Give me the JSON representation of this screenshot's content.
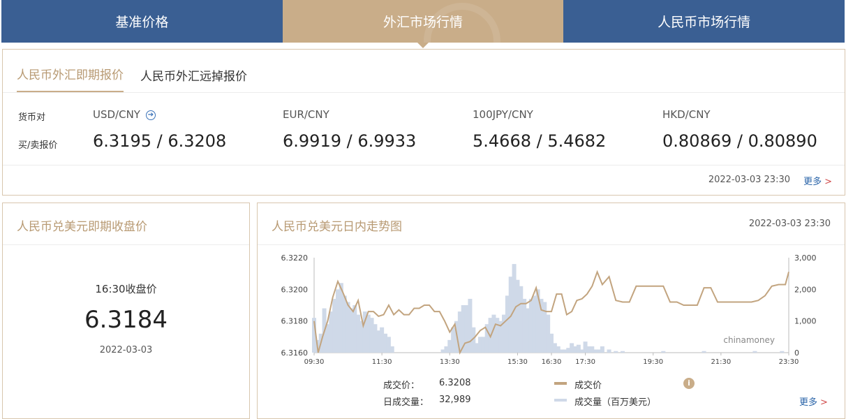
{
  "top_tabs": [
    {
      "label": "基准价格"
    },
    {
      "label": "外汇市场行情"
    },
    {
      "label": "人民币市场行情"
    }
  ],
  "quote": {
    "tabs": [
      {
        "label": "人民币外汇即期报价"
      },
      {
        "label": "人民币外汇远掉报价"
      }
    ],
    "row_labels": {
      "pair": "货币对",
      "price": "买/卖报价"
    },
    "pairs": [
      {
        "name": "USD/CNY",
        "price": "6.3195 / 6.3208"
      },
      {
        "name": "EUR/CNY",
        "price": "6.9919 / 6.9933"
      },
      {
        "name": "100JPY/CNY",
        "price": "5.4668 / 5.4682"
      },
      {
        "name": "HKD/CNY",
        "price": "0.80869 / 0.80890"
      }
    ],
    "timestamp": "2022-03-03 23:30",
    "more": "更多"
  },
  "close": {
    "title": "人民币兑美元即期收盘价",
    "label": "16:30收盘价",
    "value": "6.3184",
    "date": "2022-03-03"
  },
  "intraday": {
    "title": "人民币兑美元日内走势图",
    "timestamp": "2022-03-03 23:30",
    "watermark": "chinamoney",
    "deal_price_label": "成交价：",
    "deal_price": "6.3208",
    "volume_label": "日成交量：",
    "volume": "32,989",
    "legend_price": "成交价",
    "legend_volume": "成交量（百万美元）",
    "more": "更多",
    "price_color": "#c2a47f",
    "volume_color": "#cfd9e8"
  },
  "chart_data": {
    "type": "line",
    "x_ticks": [
      "09:30",
      "11:30",
      "13:30",
      "15:30",
      "16:30",
      "17:30",
      "19:30",
      "21:30",
      "23:30"
    ],
    "x_tick_hours": [
      9.5,
      11.5,
      13.5,
      15.5,
      16.5,
      17.5,
      19.5,
      21.5,
      23.5
    ],
    "y_left_ticks": [
      "6.3220",
      "6.3200",
      "6.3180",
      "6.3160"
    ],
    "y_left_range": [
      6.316,
      6.322
    ],
    "y_right_ticks": [
      "3,000",
      "2,000",
      "1,000",
      "0"
    ],
    "y_right_range": [
      0,
      3000
    ],
    "series": [
      {
        "name": "成交价",
        "x": [
          9.5,
          9.62,
          9.75,
          9.9,
          10.05,
          10.2,
          10.35,
          10.5,
          10.65,
          10.8,
          10.95,
          11.1,
          11.25,
          11.4,
          11.55,
          11.7,
          11.85,
          12.0,
          12.15,
          12.3,
          12.45,
          12.6,
          12.75,
          12.9,
          13.05,
          13.2,
          13.35,
          13.5,
          13.65,
          13.8,
          13.95,
          14.1,
          14.25,
          14.4,
          14.55,
          14.7,
          14.85,
          15.0,
          15.15,
          15.3,
          15.45,
          15.6,
          15.75,
          15.9,
          16.05,
          16.2,
          16.35,
          16.5,
          16.65,
          16.8,
          16.95,
          17.1,
          17.25,
          17.4,
          17.55,
          17.7,
          17.85,
          18.0,
          18.2,
          18.4,
          18.6,
          18.8,
          19.0,
          19.2,
          19.4,
          19.6,
          19.8,
          20.0,
          20.2,
          20.4,
          20.6,
          20.8,
          21.0,
          21.2,
          21.4,
          21.6,
          21.8,
          22.0,
          22.2,
          22.4,
          22.6,
          22.8,
          23.0,
          23.2,
          23.4,
          23.5
        ],
        "values": [
          6.318,
          6.316,
          6.317,
          6.318,
          6.3195,
          6.3205,
          6.3198,
          6.319,
          6.3186,
          6.3193,
          6.3177,
          6.3186,
          6.3186,
          6.3183,
          6.3184,
          6.319,
          6.3184,
          6.3187,
          6.3184,
          6.3184,
          6.3188,
          6.3188,
          6.319,
          6.319,
          6.3186,
          6.3186,
          6.318,
          6.3173,
          6.3178,
          6.316,
          6.3166,
          6.3167,
          6.317,
          6.3174,
          6.3176,
          6.317,
          6.3178,
          6.3177,
          6.318,
          6.3183,
          6.3189,
          6.3191,
          6.3191,
          6.3193,
          6.3201,
          6.3187,
          6.3186,
          6.3186,
          6.3197,
          6.3197,
          6.3184,
          6.3186,
          6.3193,
          6.3194,
          6.3197,
          6.3202,
          6.3211,
          6.3203,
          6.3208,
          6.3193,
          6.3192,
          6.3192,
          6.3202,
          6.3202,
          6.3202,
          6.3202,
          6.3202,
          6.3192,
          6.3192,
          6.319,
          6.319,
          6.319,
          6.3201,
          6.3201,
          6.3192,
          6.3192,
          6.3192,
          6.3192,
          6.3192,
          6.3192,
          6.3193,
          6.3196,
          6.3202,
          6.3203,
          6.3203,
          6.3211
        ]
      },
      {
        "name": "成交量（百万美元）",
        "x": [
          9.5,
          9.6,
          9.7,
          9.8,
          9.9,
          10.0,
          10.1,
          10.2,
          10.3,
          10.4,
          10.5,
          10.6,
          10.7,
          10.8,
          10.9,
          11.0,
          11.1,
          11.2,
          11.3,
          11.4,
          11.5,
          11.6,
          11.7,
          11.8,
          13.3,
          13.4,
          13.5,
          13.6,
          13.7,
          13.8,
          13.9,
          14.0,
          14.1,
          14.2,
          14.3,
          14.4,
          14.5,
          14.6,
          14.7,
          14.8,
          14.9,
          15.0,
          15.1,
          15.2,
          15.3,
          15.4,
          15.5,
          15.6,
          15.7,
          15.8,
          15.9,
          16.0,
          16.1,
          16.2,
          16.3,
          16.4,
          16.5,
          16.6,
          16.7,
          16.8,
          16.9,
          17.0,
          17.1,
          17.2,
          17.3,
          17.4,
          17.5,
          17.6,
          17.7,
          17.8,
          17.9,
          18.0,
          18.2,
          18.4,
          18.6,
          19.8,
          21.0,
          22.5,
          23.3
        ],
        "values": [
          1100,
          400,
          600,
          1400,
          900,
          1300,
          1700,
          2000,
          2200,
          1800,
          1600,
          1400,
          1500,
          1200,
          1000,
          1300,
          1200,
          1100,
          900,
          700,
          800,
          600,
          500,
          200,
          100,
          200,
          400,
          800,
          1000,
          1300,
          1500,
          1500,
          1700,
          800,
          300,
          500,
          500,
          900,
          1100,
          1200,
          1100,
          1000,
          1200,
          1800,
          2400,
          2800,
          2300,
          2100,
          1700,
          1400,
          1700,
          1800,
          2000,
          1700,
          1600,
          1200,
          600,
          300,
          200,
          100,
          100,
          150,
          300,
          200,
          250,
          100,
          350,
          200,
          200,
          100,
          100,
          200,
          100,
          50,
          50,
          50,
          50,
          50,
          50
        ]
      }
    ]
  }
}
